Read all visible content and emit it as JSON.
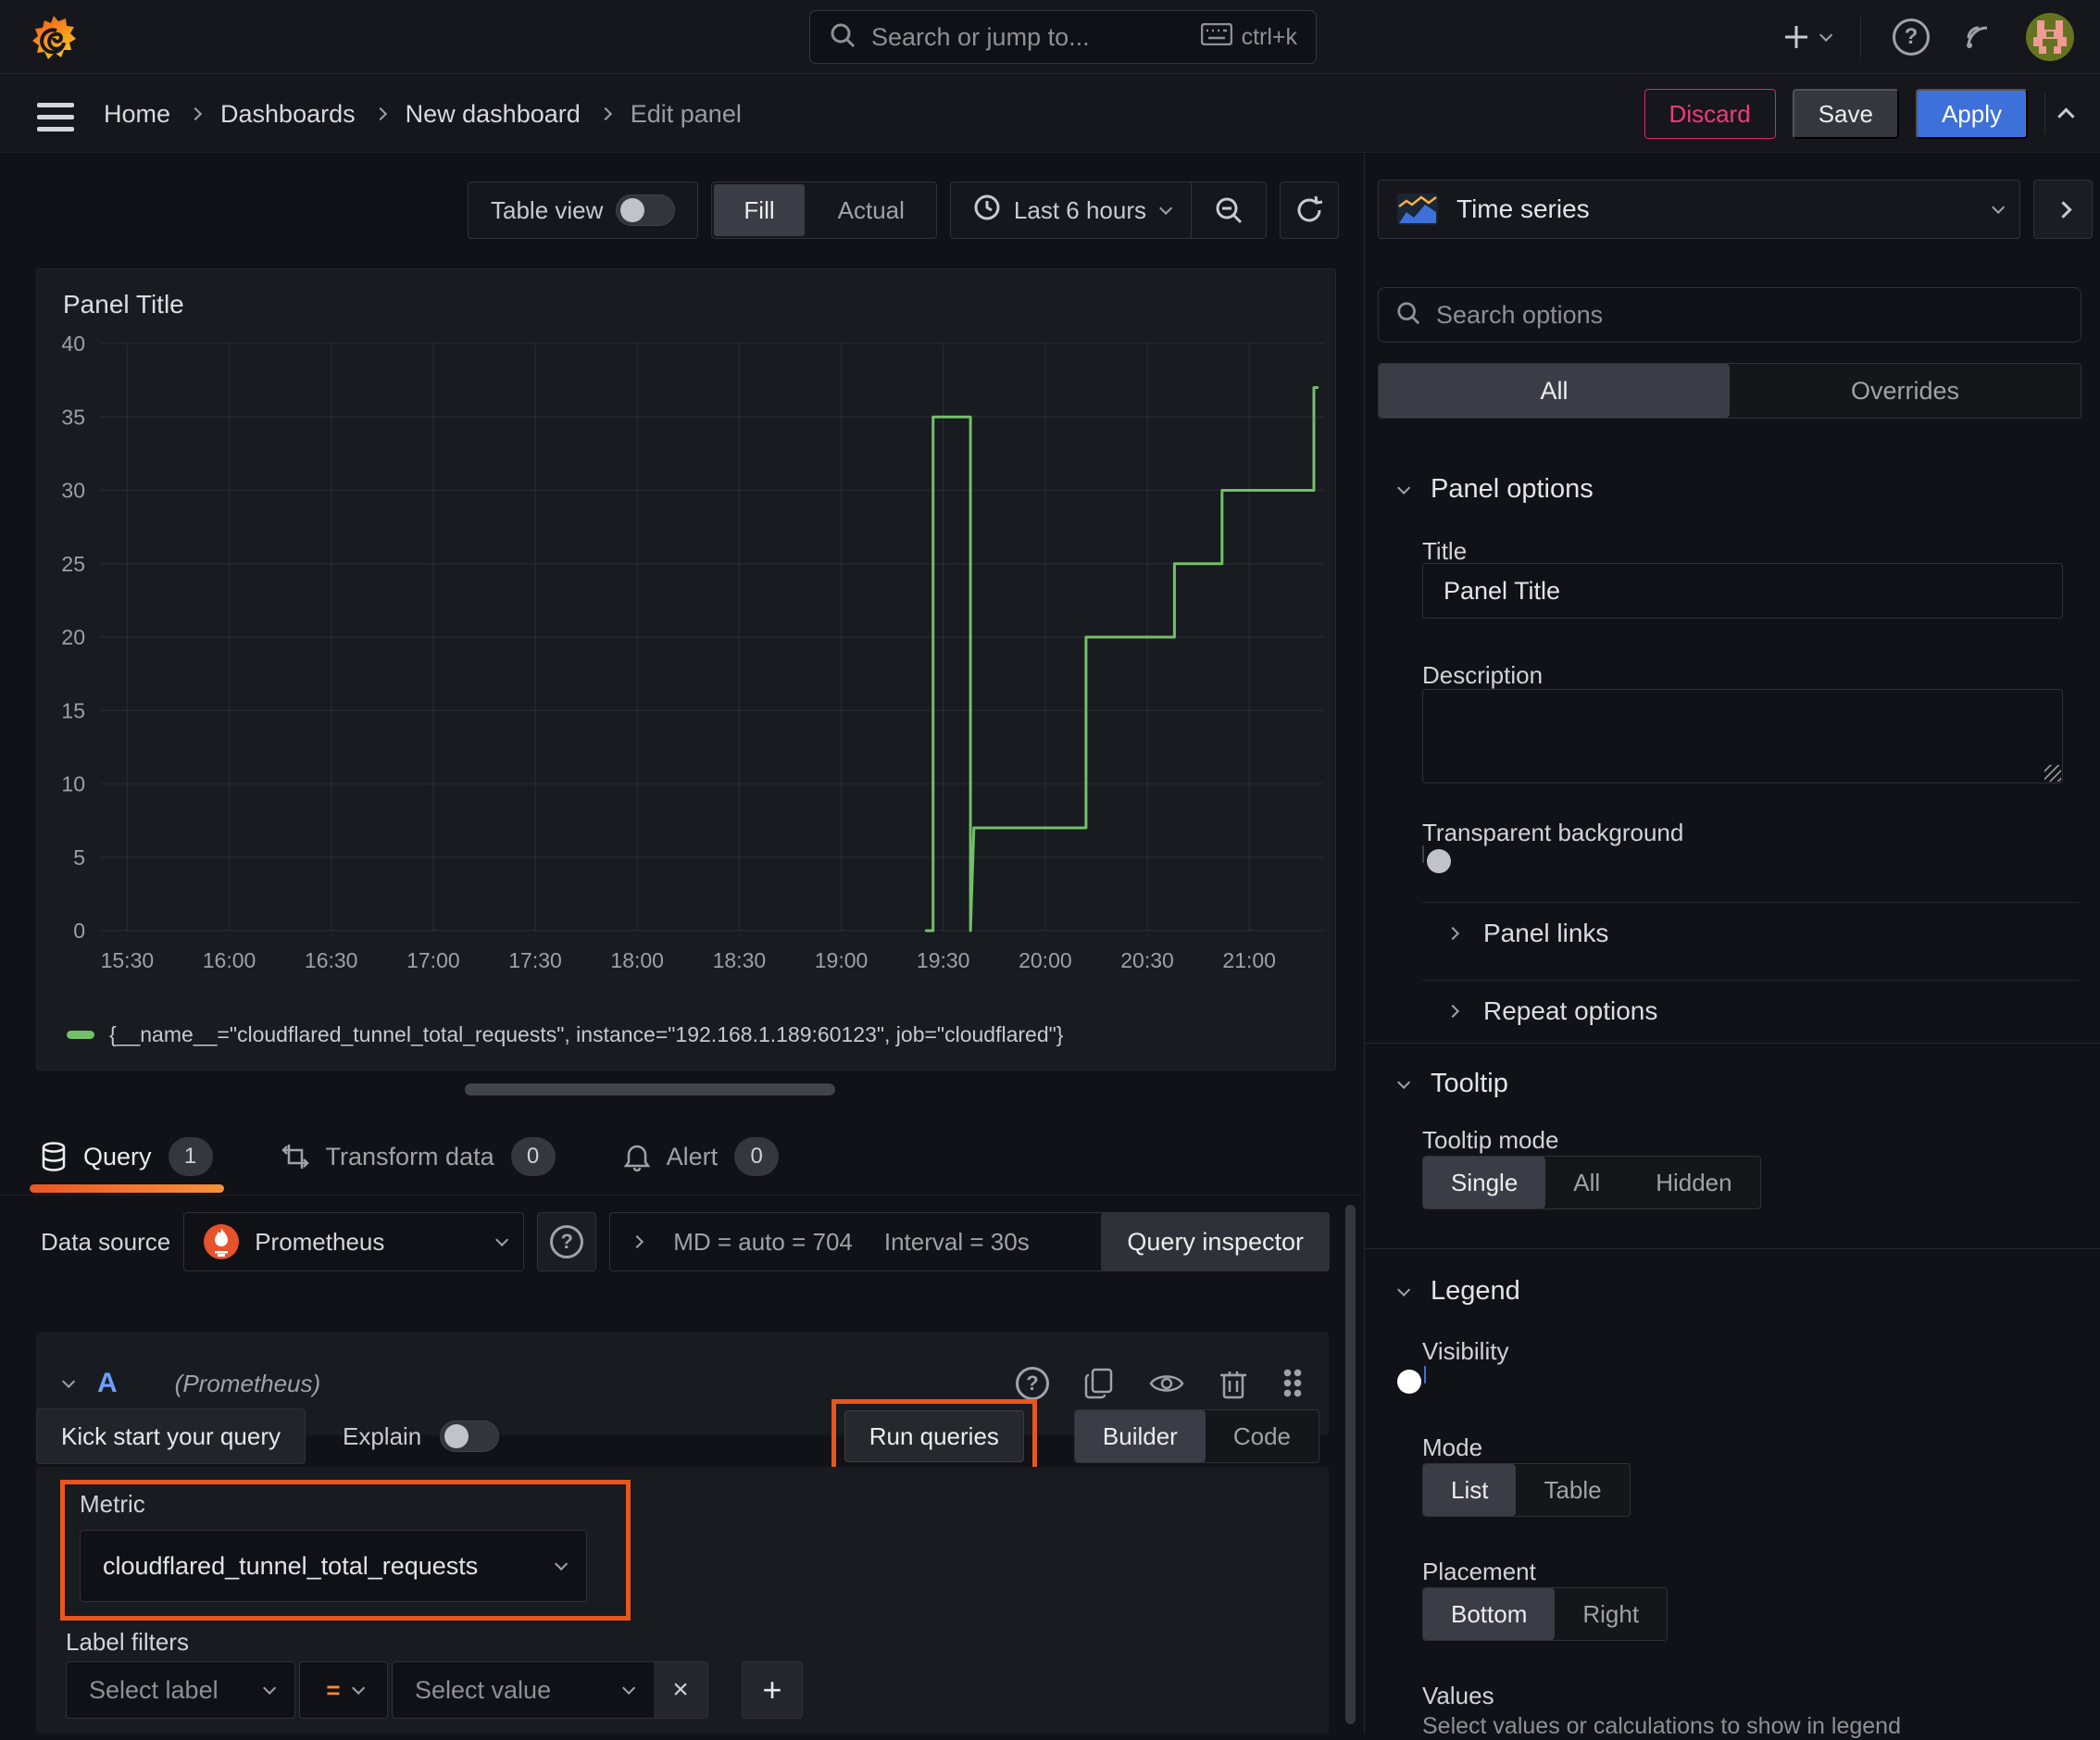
{
  "topbar": {
    "search_placeholder": "Search or jump to...",
    "shortcut": "ctrl+k"
  },
  "breadcrumb": {
    "items": [
      "Home",
      "Dashboards",
      "New dashboard",
      "Edit panel"
    ]
  },
  "actions": {
    "discard": "Discard",
    "save": "Save",
    "apply": "Apply"
  },
  "panel_controls": {
    "table_view": "Table view",
    "fill": "Fill",
    "actual": "Actual",
    "time_range": "Last 6 hours"
  },
  "panel": {
    "title": "Panel Title"
  },
  "chart_data": {
    "type": "line",
    "title": "Panel Title",
    "x_range": [
      "15:22",
      "21:22"
    ],
    "x_ticks": [
      "15:30",
      "16:00",
      "16:30",
      "17:00",
      "17:30",
      "18:00",
      "18:30",
      "19:00",
      "19:30",
      "20:00",
      "20:30",
      "21:00"
    ],
    "y_ticks": [
      0,
      5,
      10,
      15,
      20,
      25,
      30,
      35,
      40
    ],
    "ylim": [
      0,
      40
    ],
    "grid": true,
    "legend_position": "bottom",
    "series": [
      {
        "name": "{__name__=\"cloudflared_tunnel_total_requests\", instance=\"192.168.1.189:60123\", job=\"cloudflared\"}",
        "color": "#73bf69",
        "points": [
          [
            "19:25",
            0
          ],
          [
            "19:27",
            0
          ],
          [
            "19:27",
            35
          ],
          [
            "19:38",
            35
          ],
          [
            "19:38",
            0
          ],
          [
            "19:39",
            7
          ],
          [
            "20:12",
            7
          ],
          [
            "20:12",
            20
          ],
          [
            "20:38",
            20
          ],
          [
            "20:38",
            25
          ],
          [
            "20:52",
            25
          ],
          [
            "20:52",
            30
          ],
          [
            "21:19",
            30
          ],
          [
            "21:19",
            37
          ],
          [
            "21:20",
            37
          ]
        ]
      }
    ]
  },
  "tabs": {
    "query": "Query",
    "query_count": "1",
    "transform": "Transform data",
    "transform_count": "0",
    "alert": "Alert",
    "alert_count": "0"
  },
  "datasource": {
    "label": "Data source",
    "name": "Prometheus",
    "md": "MD = auto = 704",
    "interval": "Interval = 30s",
    "query_inspector": "Query inspector"
  },
  "query_row": {
    "ref": "A",
    "ds_hint": "(Prometheus)"
  },
  "query_editor": {
    "kick_start": "Kick start your query",
    "explain": "Explain",
    "run_queries": "Run queries",
    "builder": "Builder",
    "code": "Code",
    "metric_label": "Metric",
    "metric_value": "cloudflared_tunnel_total_requests",
    "label_filters": "Label filters",
    "select_label": "Select label",
    "operator": "=",
    "select_value": "Select value"
  },
  "options": {
    "viz": "Time series",
    "search_placeholder": "Search options",
    "tab_all": "All",
    "tab_overrides": "Overrides",
    "panel_options": {
      "title": "Panel options",
      "title_label": "Title",
      "title_value": "Panel Title",
      "description_label": "Description",
      "transparent_label": "Transparent background"
    },
    "collapsed": {
      "panel_links": "Panel links",
      "repeat_options": "Repeat options"
    },
    "tooltip": {
      "title": "Tooltip",
      "mode_label": "Tooltip mode",
      "modes": [
        "Single",
        "All",
        "Hidden"
      ]
    },
    "legend": {
      "title": "Legend",
      "visibility_label": "Visibility",
      "mode_label": "Mode",
      "modes": [
        "List",
        "Table"
      ],
      "placement_label": "Placement",
      "placements": [
        "Bottom",
        "Right"
      ],
      "values_label": "Values",
      "values_help": "Select values or calculations to show in legend"
    }
  },
  "colors": {
    "accent_blue": "#3d71d9",
    "series_green": "#73bf69",
    "annotation_orange": "#e8561f",
    "discard_pink": "#e0226e",
    "tab_underline_from": "#ed5622",
    "tab_underline_to": "#f8923a"
  }
}
